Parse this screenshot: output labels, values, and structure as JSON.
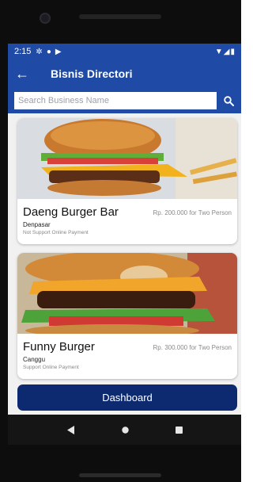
{
  "status_bar": {
    "time": "2:15",
    "icons_left": [
      "gear-icon",
      "circle-check-icon",
      "play-icon"
    ],
    "icons_right": [
      "wifi-icon",
      "signal-icon",
      "battery-icon"
    ]
  },
  "app_bar": {
    "title": "Bisnis Directori",
    "back_icon": "arrow-back-icon",
    "color": "#1f4ba6"
  },
  "search": {
    "placeholder": "Search Business Name",
    "value": "",
    "icon": "search-icon"
  },
  "businesses": [
    {
      "name": "Daeng Burger Bar",
      "price": "Rp. 200.000 for Two Person",
      "city": "Denpasar",
      "payment": "Not Support Online Payment"
    },
    {
      "name": "Funny Burger",
      "price": "Rp. 300.000 for Two Person",
      "city": "Canggu",
      "payment": "Support Online Payment"
    }
  ],
  "dashboard_button": {
    "label": "Dashboard",
    "color": "#0d2a70"
  },
  "nav_bar": {
    "icons": [
      "back-triangle-icon",
      "home-circle-icon",
      "recents-square-icon"
    ]
  }
}
